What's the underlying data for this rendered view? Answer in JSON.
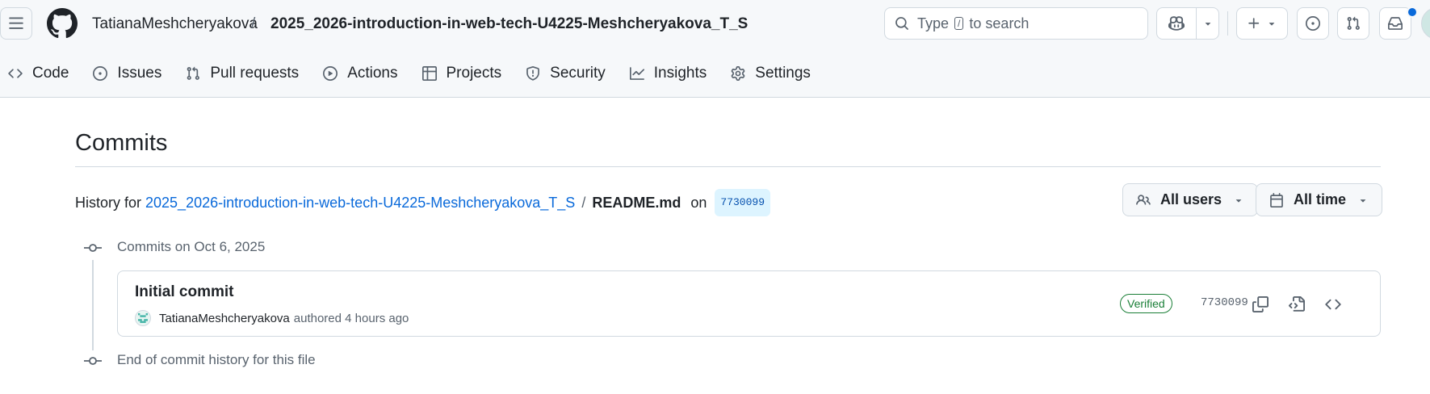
{
  "header": {
    "owner": "TatianaMeshcheryakova",
    "separator": "/",
    "repo": "2025_2026-introduction-in-web-tech-U4225-Meshcheryakova_T_S",
    "search": {
      "prefix": "Type",
      "key": "/",
      "suffix": "to search"
    }
  },
  "nav": {
    "items": [
      {
        "label": "Code",
        "icon": "code-icon"
      },
      {
        "label": "Issues",
        "icon": "issue-icon"
      },
      {
        "label": "Pull requests",
        "icon": "git-pull-request-icon"
      },
      {
        "label": "Actions",
        "icon": "play-icon"
      },
      {
        "label": "Projects",
        "icon": "table-icon"
      },
      {
        "label": "Security",
        "icon": "shield-icon"
      },
      {
        "label": "Insights",
        "icon": "graph-icon"
      },
      {
        "label": "Settings",
        "icon": "gear-icon"
      }
    ]
  },
  "page": {
    "title": "Commits",
    "history_prefix": "History for",
    "history_repo_link": "2025_2026-introduction-in-web-tech-U4225-Meshcheryakova_T_S",
    "history_slash": "/",
    "history_file": "README.md",
    "history_on": "on",
    "history_sha": "7730099"
  },
  "filters": {
    "users": "All users",
    "time": "All time"
  },
  "timeline": {
    "group_heading": "Commits on Oct 6, 2025",
    "end_text": "End of commit history for this file",
    "commits": [
      {
        "title": "Initial commit",
        "author": "TatianaMeshcheryakova",
        "action": "authored",
        "time": "4 hours ago",
        "badge": "Verified",
        "sha": "7730099"
      }
    ]
  },
  "colors": {
    "accent": "#0969da",
    "success": "#1a7f37",
    "border": "#d1d9e0",
    "header_bg": "#f6f8fa"
  }
}
